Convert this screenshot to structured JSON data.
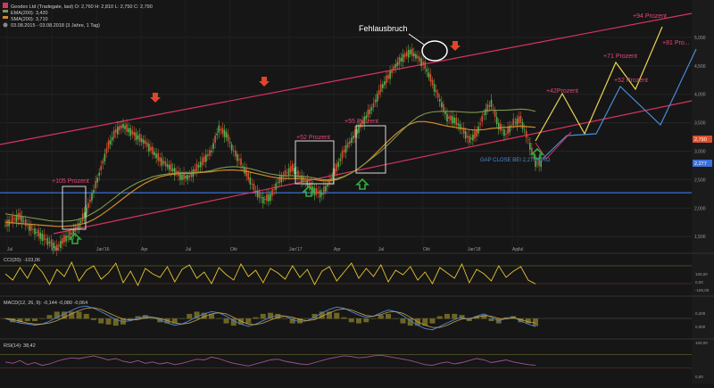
{
  "header": {
    "line1": "Geodex Ltd (Tradegate, last) O: 2,760 H: 2,810 L: 2,750 C: 2,790",
    "line2": "EMA(200): 3,420",
    "line3": "SMA(200): 3,710",
    "line4": "03.08.2015 - 03.08.2018 (3 Jahre, 1 Tag)"
  },
  "colors": {
    "background": "#161616",
    "channel": "#d8345f",
    "support": "#3a6fd8",
    "ema": "#d18a2a",
    "sma": "#7e9a4e",
    "candle_up": "#57b04f",
    "candle_down": "#d9502f",
    "projection_up": "#e9d24f",
    "projection_alt": "#4a8ad8",
    "cci": "#e2c230",
    "macd": "#4c7fc7",
    "rsi": "#a2528f",
    "arrow_red": "#e0452a",
    "arrow_green": "#2fae3d"
  },
  "chart_data": {
    "type": "line",
    "title": "Geodex Ltd (Tradegate, last)",
    "x_ticks": [
      "Jul",
      "Okt",
      "Jan'16",
      "Apr",
      "Jul",
      "Okt",
      "Jan'17",
      "Apr",
      "Jul",
      "Okt",
      "Jan'18",
      "Apr",
      "Jul"
    ],
    "y_ticks": [
      "5,000",
      "4,500",
      "4,000",
      "3,500",
      "3,000",
      "2,500",
      "2,000",
      "1,500"
    ],
    "ylim": [
      1.3,
      5.5
    ],
    "price_labels": {
      "last": "2,790",
      "support": "2,277"
    },
    "support_level": 2.27,
    "series": [
      {
        "name": "Kurs",
        "values": [
          1.7,
          1.8,
          1.85,
          1.7,
          1.6,
          1.5,
          1.4,
          1.3,
          1.45,
          1.55,
          1.7,
          1.95,
          2.3,
          2.7,
          3.1,
          3.35,
          3.45,
          3.35,
          3.25,
          3.15,
          3.0,
          2.85,
          2.75,
          2.65,
          2.55,
          2.55,
          2.7,
          2.85,
          3.0,
          3.4,
          3.3,
          3.0,
          2.8,
          2.55,
          2.3,
          2.15,
          2.2,
          2.45,
          2.6,
          2.7,
          2.55,
          2.45,
          2.3,
          2.25,
          2.45,
          2.7,
          3.0,
          3.2,
          3.4,
          3.6,
          3.8,
          4.1,
          4.3,
          4.5,
          4.65,
          4.75,
          4.65,
          4.5,
          4.2,
          3.9,
          3.6,
          3.55,
          3.4,
          3.2,
          3.3,
          3.65,
          3.85,
          3.45,
          3.3,
          3.5,
          3.55,
          3.2,
          2.79
        ]
      },
      {
        "name": "EMA(200)",
        "values": [
          1.9,
          1.88,
          1.86,
          1.84,
          1.82,
          1.8,
          1.78,
          1.77,
          1.77,
          1.78,
          1.8,
          1.85,
          1.92,
          2.0,
          2.1,
          2.2,
          2.3,
          2.38,
          2.45,
          2.5,
          2.55,
          2.58,
          2.6,
          2.61,
          2.62,
          2.62,
          2.63,
          2.64,
          2.66,
          2.7,
          2.72,
          2.73,
          2.72,
          2.7,
          2.67,
          2.63,
          2.6,
          2.58,
          2.57,
          2.57,
          2.56,
          2.55,
          2.53,
          2.5,
          2.5,
          2.52,
          2.56,
          2.62,
          2.7,
          2.8,
          2.9,
          3.0,
          3.12,
          3.25,
          3.38,
          3.5,
          3.6,
          3.66,
          3.69,
          3.7,
          3.7,
          3.7,
          3.69,
          3.68,
          3.68,
          3.7,
          3.72,
          3.72,
          3.72,
          3.73,
          3.74,
          3.73,
          3.7
        ]
      },
      {
        "name": "SMA(200)",
        "values": [
          1.75,
          1.74,
          1.73,
          1.72,
          1.71,
          1.7,
          1.69,
          1.68,
          1.68,
          1.69,
          1.71,
          1.74,
          1.8,
          1.88,
          1.97,
          2.07,
          2.17,
          2.27,
          2.36,
          2.44,
          2.5,
          2.55,
          2.58,
          2.6,
          2.61,
          2.61,
          2.62,
          2.63,
          2.64,
          2.66,
          2.67,
          2.67,
          2.66,
          2.64,
          2.61,
          2.58,
          2.55,
          2.53,
          2.52,
          2.52,
          2.52,
          2.51,
          2.5,
          2.48,
          2.48,
          2.5,
          2.55,
          2.62,
          2.7,
          2.8,
          2.92,
          3.05,
          3.18,
          3.3,
          3.4,
          3.48,
          3.52,
          3.52,
          3.5,
          3.47,
          3.44,
          3.42,
          3.4,
          3.38,
          3.37,
          3.38,
          3.4,
          3.41,
          3.42,
          3.43,
          3.44,
          3.43,
          3.42
        ]
      }
    ]
  },
  "annotations": {
    "fehlausbruch": "Fehlausbruch",
    "p105": "+105 Prozent",
    "p52a": "+52 Prozent",
    "p55": "+55 Prozent",
    "p42": "+42Prozent",
    "p71": "+71 Prozent",
    "p52b": "+52 Prozent",
    "p94": "+94 Prozent",
    "p81": "+81 Pro...",
    "gap": "GAP CLOSE BEI 2,27 EURO"
  },
  "indicators": {
    "cci": {
      "label": "CCI(20): -103,06",
      "ticks": [
        "100,00",
        "0,00",
        "-100,00"
      ],
      "values": [
        10,
        -60,
        80,
        -40,
        120,
        30,
        -110,
        60,
        -20,
        140,
        -70,
        50,
        100,
        -50,
        20,
        130,
        -90,
        40,
        -120,
        70,
        10,
        -30,
        90,
        -80,
        60,
        110,
        -40,
        30,
        -100,
        80,
        0,
        -60,
        120,
        -20,
        50,
        -90,
        70,
        20,
        -50,
        100,
        -30,
        60,
        -110,
        40,
        90,
        -70,
        30,
        130,
        -40,
        70,
        -20,
        110,
        -80,
        50,
        0,
        90,
        -60,
        30,
        -100,
        80,
        20,
        -40,
        120,
        -90,
        60,
        10,
        -70,
        100,
        -30,
        40,
        90,
        -60,
        -103
      ]
    },
    "macd": {
      "label": "MACD(12, 26, 9): -0,144  -0,080  -0,064",
      "ticks": [
        "0,200",
        "0,000"
      ],
      "values": [
        0.0,
        -0.05,
        -0.08,
        -0.1,
        -0.12,
        -0.1,
        -0.05,
        0.02,
        0.08,
        0.14,
        0.2,
        0.22,
        0.18,
        0.12,
        0.05,
        -0.02,
        -0.06,
        -0.04,
        0.0,
        0.04,
        0.02,
        -0.03,
        -0.08,
        -0.12,
        -0.1,
        -0.04,
        0.03,
        0.08,
        0.12,
        0.1,
        0.04,
        -0.04,
        -0.1,
        -0.14,
        -0.1,
        -0.04,
        0.02,
        0.06,
        0.04,
        -0.02,
        -0.06,
        -0.04,
        0.02,
        0.1,
        0.16,
        0.2,
        0.18,
        0.12,
        0.06,
        0.02,
        0.04,
        0.1,
        0.15,
        0.12,
        0.05,
        -0.04,
        -0.12,
        -0.18,
        -0.2,
        -0.14,
        -0.08,
        -0.02,
        0.02,
        -0.02,
        0.04,
        0.08,
        0.02,
        -0.04,
        0.0,
        0.03,
        -0.05,
        -0.1,
        -0.144
      ],
      "signal": [
        0.0,
        -0.02,
        -0.05,
        -0.08,
        -0.1,
        -0.1,
        -0.08,
        -0.04,
        0.02,
        0.08,
        0.14,
        0.18,
        0.19,
        0.16,
        0.1,
        0.04,
        -0.01,
        -0.03,
        -0.02,
        0.01,
        0.02,
        0.0,
        -0.04,
        -0.08,
        -0.1,
        -0.08,
        -0.03,
        0.03,
        0.08,
        0.1,
        0.08,
        0.02,
        -0.05,
        -0.1,
        -0.11,
        -0.08,
        -0.03,
        0.02,
        0.04,
        0.02,
        -0.02,
        -0.04,
        -0.02,
        0.04,
        0.1,
        0.15,
        0.17,
        0.15,
        0.1,
        0.05,
        0.04,
        0.07,
        0.11,
        0.12,
        0.09,
        0.02,
        -0.06,
        -0.12,
        -0.16,
        -0.16,
        -0.12,
        -0.06,
        -0.01,
        0.0,
        0.02,
        0.05,
        0.04,
        0.0,
        -0.01,
        0.01,
        -0.02,
        -0.06,
        -0.08
      ]
    },
    "rsi": {
      "label": "RSI(14): 38,42",
      "ticks": [
        "100,00",
        "0,00"
      ],
      "values": [
        48,
        44,
        52,
        40,
        46,
        38,
        42,
        50,
        56,
        60,
        58,
        62,
        66,
        60,
        54,
        58,
        50,
        46,
        52,
        44,
        48,
        42,
        46,
        40,
        44,
        50,
        56,
        54,
        62,
        58,
        50,
        44,
        40,
        36,
        42,
        48,
        54,
        56,
        50,
        46,
        42,
        40,
        46,
        52,
        58,
        62,
        66,
        64,
        60,
        62,
        66,
        68,
        64,
        60,
        56,
        52,
        46,
        40,
        38,
        44,
        48,
        42,
        46,
        52,
        58,
        54,
        46,
        50,
        54,
        48,
        44,
        40,
        38.42
      ]
    }
  }
}
